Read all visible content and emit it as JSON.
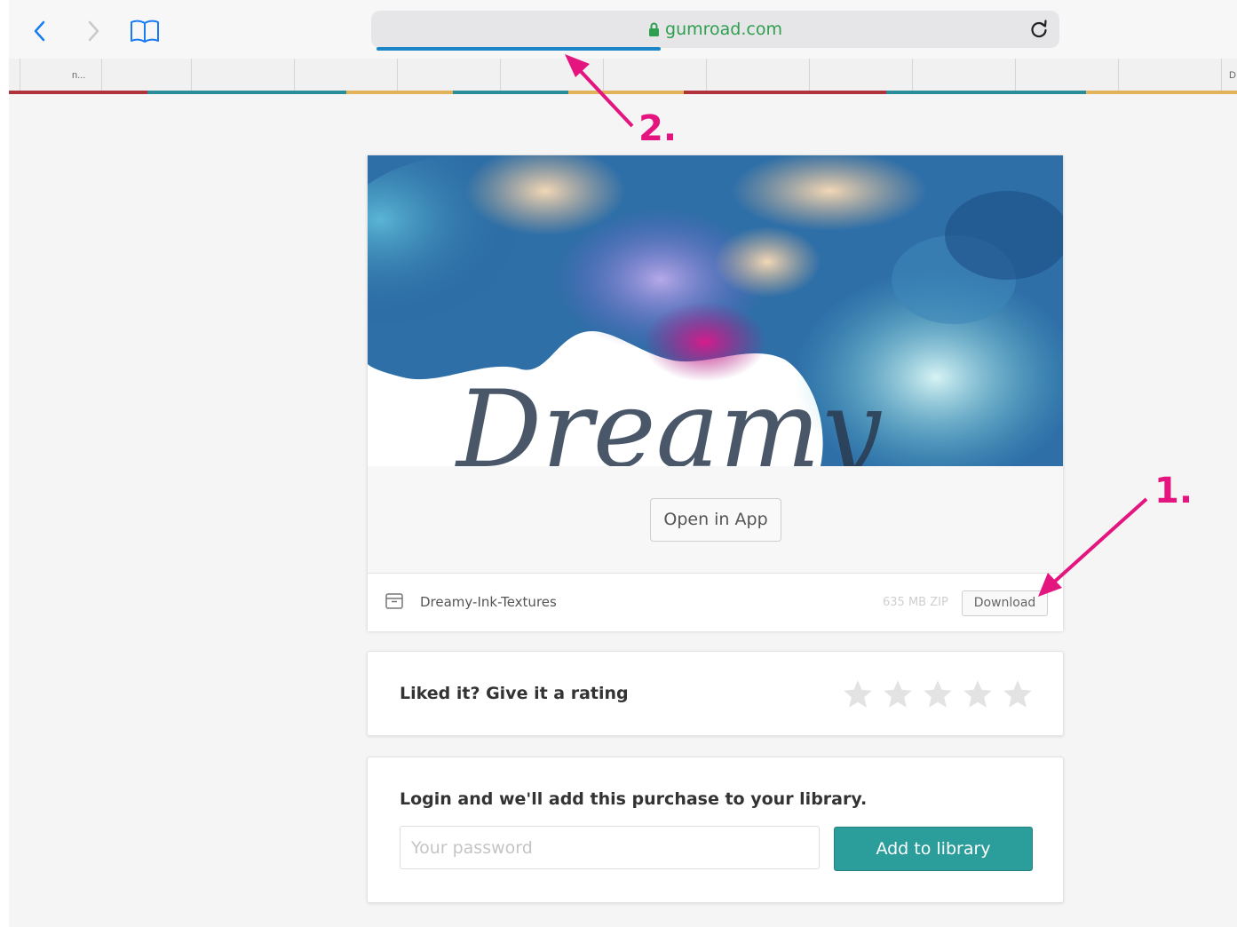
{
  "browser": {
    "url": "gumroad.com",
    "page_load_progress": 0.42,
    "tab_label_left": "n...",
    "tab_label_right": "D"
  },
  "product": {
    "cover_alt": "Dreamy",
    "open_in_app_label": "Open in App",
    "file": {
      "name": "Dreamy-Ink-Textures",
      "size": "635 MB ZIP",
      "download_label": "Download"
    }
  },
  "rating": {
    "prompt": "Liked it? Give it a rating",
    "stars_total": 5,
    "stars_filled": 0
  },
  "login": {
    "prompt": "Login and we'll add this purchase to your library.",
    "password_placeholder": "Your password",
    "add_button_label": "Add to library"
  },
  "annotations": {
    "label_1": "1.",
    "label_2": "2."
  },
  "colors": {
    "annotation": "#e4157f",
    "url_green": "#2e9e4f",
    "progress_blue": "#1a86c8",
    "button_teal": "#2b9d9b"
  }
}
